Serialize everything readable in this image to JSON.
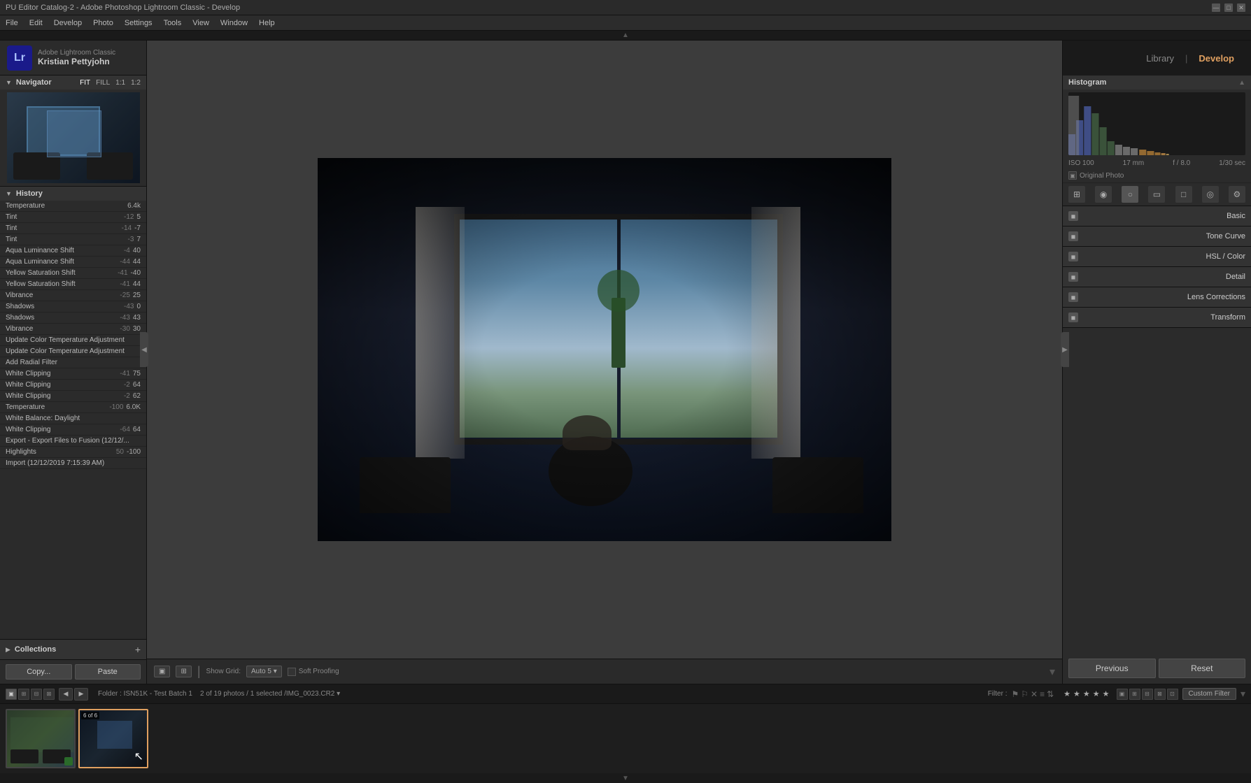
{
  "titlebar": {
    "title": "PU Editor Catalog-2 - Adobe Photoshop Lightroom Classic - Develop",
    "min_label": "—",
    "max_label": "□",
    "close_label": "✕"
  },
  "menubar": {
    "items": [
      "File",
      "Edit",
      "Develop",
      "Photo",
      "Settings",
      "Tools",
      "View",
      "Window",
      "Help"
    ]
  },
  "lr_header": {
    "app_name": "Adobe Lightroom Classic",
    "user_name": "Kristian Pettyjohn",
    "logo_text": "Lr"
  },
  "module_tabs": {
    "library_label": "Library",
    "develop_label": "Develop",
    "separator": "|"
  },
  "navigator": {
    "label": "Navigator",
    "zoom_fit": "FIT",
    "zoom_fill": "FILL",
    "zoom_1to1": "1:1",
    "zoom_custom": "1:2"
  },
  "history": {
    "items": [
      {
        "name": "Temperature",
        "before": "",
        "after": "6.4k"
      },
      {
        "name": "Tint",
        "before": "-12",
        "after": "5"
      },
      {
        "name": "Tint",
        "before": "-14",
        "after": "-7"
      },
      {
        "name": "Tint",
        "before": "-3",
        "after": "7"
      },
      {
        "name": "Aqua Luminance Shift",
        "before": "-4",
        "after": "40"
      },
      {
        "name": "Aqua Luminance Shift",
        "before": "-44",
        "after": "44"
      },
      {
        "name": "Yellow Saturation Shift",
        "before": "-41",
        "after": "-40"
      },
      {
        "name": "Yellow Saturation Shift",
        "before": "-41",
        "after": "44"
      },
      {
        "name": "Vibrance",
        "before": "-25",
        "after": "25"
      },
      {
        "name": "Shadows",
        "before": "-43",
        "after": "0"
      },
      {
        "name": "Shadows",
        "before": "-43",
        "after": "43"
      },
      {
        "name": "Vibrance",
        "before": "-30",
        "after": "30"
      },
      {
        "name": "Update Color Temperature Adjustment",
        "before": "",
        "after": ""
      },
      {
        "name": "Update Color Temperature Adjustment",
        "before": "",
        "after": ""
      },
      {
        "name": "Add Radial Filter",
        "before": "",
        "after": ""
      },
      {
        "name": "White Clipping",
        "before": "-41",
        "after": "75"
      },
      {
        "name": "White Clipping",
        "before": "-2",
        "after": "64"
      },
      {
        "name": "White Clipping",
        "before": "-2",
        "after": "62"
      },
      {
        "name": "Temperature",
        "before": "-100",
        "after": "6.0K"
      },
      {
        "name": "White Balance: Daylight",
        "before": "",
        "after": ""
      },
      {
        "name": "White Clipping",
        "before": "-64",
        "after": "64"
      },
      {
        "name": "Export - Export Files to Fusion (12/12/...",
        "before": "",
        "after": ""
      },
      {
        "name": "Highlights",
        "before": "50",
        "after": "-100"
      },
      {
        "name": "Import (12/12/2019 7:15:39 AM)",
        "before": "",
        "after": ""
      }
    ]
  },
  "collections": {
    "label": "Collections",
    "add_label": "+"
  },
  "copy_paste": {
    "copy_label": "Copy...",
    "paste_label": "Paste"
  },
  "canvas_toolbar": {
    "view_btn1": "▣",
    "view_btn2": "⊞",
    "grid_label": "Show Grid:",
    "grid_value": "Auto 5",
    "soft_proofing_label": "Soft Proofing"
  },
  "histogram": {
    "label": "Histogram",
    "iso": "ISO 100",
    "focal": "17 mm",
    "aperture": "f / 8.0",
    "shutter": "1/30 sec",
    "original_photo": "Original Photo"
  },
  "right_sections": [
    {
      "label": "Basic"
    },
    {
      "label": "Tone Curve"
    },
    {
      "label": "HSL / Color"
    },
    {
      "label": "Detail"
    },
    {
      "label": "Lens Corrections"
    },
    {
      "label": "Transform"
    }
  ],
  "prev_reset": {
    "previous_label": "Previous",
    "reset_label": "Reset"
  },
  "filmstrip_bar": {
    "folder_info": "Folder : ISN51K - Test Batch 1",
    "photo_count": "2 of 19 photos / 1 selected",
    "filename": "/IMG_0023.CR2",
    "filter_label": "Filter :"
  },
  "filmstrip": {
    "thumb1": {
      "badge": "",
      "type": "light"
    },
    "thumb2": {
      "badge": "6 of 6",
      "type": "dark"
    }
  },
  "custom_filter": "Custom Filter"
}
